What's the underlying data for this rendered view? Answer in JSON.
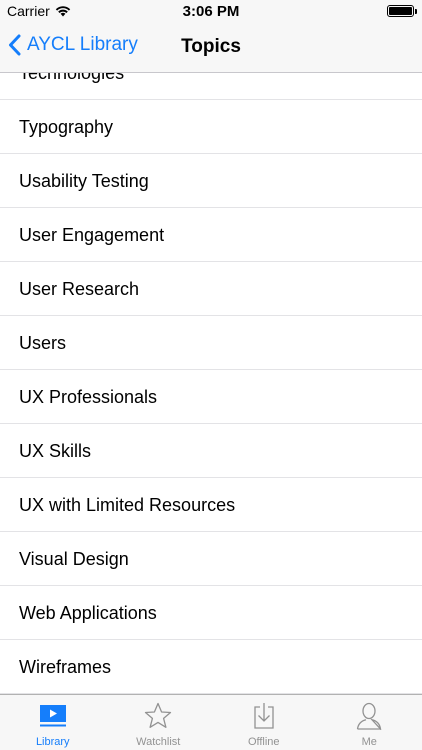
{
  "status_bar": {
    "carrier": "Carrier",
    "time": "3:06 PM",
    "icons": [
      "wifi-icon",
      "battery-icon"
    ]
  },
  "nav": {
    "back_label": "AYCL Library",
    "title": "Topics",
    "accent_color": "#157efb"
  },
  "topics": [
    "Technologies",
    "Typography",
    "Usability Testing",
    "User Engagement",
    "User Research",
    "Users",
    "UX Professionals",
    "UX Skills",
    "UX with Limited Resources",
    "Visual Design",
    "Web Applications",
    "Wireframes"
  ],
  "tabs": [
    {
      "label": "Library",
      "icon": "library-icon",
      "active": true
    },
    {
      "label": "Watchlist",
      "icon": "star-icon",
      "active": false
    },
    {
      "label": "Offline",
      "icon": "download-icon",
      "active": false
    },
    {
      "label": "Me",
      "icon": "person-icon",
      "active": false
    }
  ]
}
